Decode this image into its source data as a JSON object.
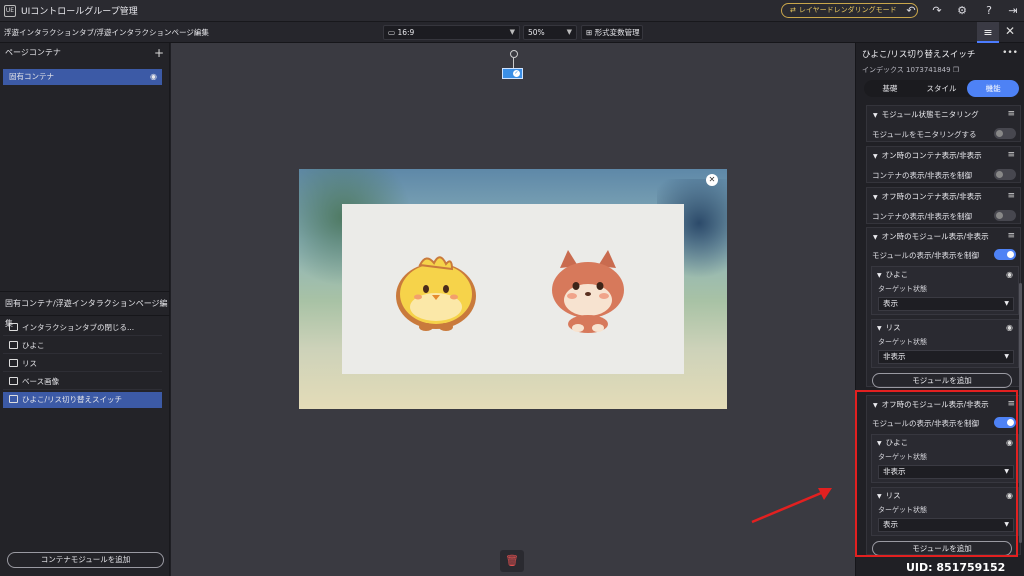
{
  "app": {
    "logo_text": "UE",
    "title": "UIコントロールグループ管理",
    "mode_button": "レイヤードレンダリングモード",
    "icons": [
      "swap-icon",
      "undo-icon",
      "redo-icon",
      "settings-icon",
      "help-icon",
      "exit-icon"
    ]
  },
  "toolbar": {
    "breadcrumb": "浮遊インタラクションタブ/浮遊インタラクションページ編集",
    "aspect": "16:9",
    "zoom": "50%",
    "format_button": "形式変数管理"
  },
  "left": {
    "page_contents_title": "ページコンテナ",
    "page_items": [
      {
        "label": "固有コンテナ"
      }
    ],
    "edit_title": "固有コンテナ/浮遊インタラクションページ編集",
    "edit_items": [
      {
        "label": "インタラクションタブの閉じる..."
      },
      {
        "label": "ひよこ"
      },
      {
        "label": "リス"
      },
      {
        "label": "ベース画像"
      },
      {
        "label": "ひよこ/リス切り替えスイッチ"
      }
    ],
    "add_container": "コンテナモジュールを追加"
  },
  "right": {
    "title": "ひよこ/リス切り替えスイッチ",
    "index": "インデックス 1073741849",
    "tabs": [
      "基礎",
      "スタイル",
      "機能"
    ],
    "active_tab": "機能",
    "groups": {
      "monitor": {
        "title": "モジュール状態モニタリング",
        "row": "モジュールをモニタリングする",
        "on": false
      },
      "on_container": {
        "title": "オン時のコンテナ表示/非表示",
        "row": "コンテナの表示/非表示を制御",
        "on": false
      },
      "off_container": {
        "title": "オフ時のコンテナ表示/非表示",
        "row": "コンテナの表示/非表示を制御",
        "on": false
      },
      "on_module": {
        "title": "オン時のモジュール表示/非表示",
        "row": "モジュールの表示/非表示を制御",
        "on": true,
        "items": [
          {
            "name": "ひよこ",
            "label": "ターゲット状態",
            "value": "表示"
          },
          {
            "name": "リス",
            "label": "ターゲット状態",
            "value": "非表示"
          }
        ],
        "add": "モジュールを追加"
      },
      "off_module": {
        "title": "オフ時のモジュール表示/非表示",
        "row": "モジュールの表示/非表示を制御",
        "on": true,
        "items": [
          {
            "name": "ひよこ",
            "label": "ターゲット状態",
            "value": "非表示"
          },
          {
            "name": "リス",
            "label": "ターゲット状態",
            "value": "表示"
          }
        ],
        "add": "モジュールを追加"
      }
    }
  },
  "uid": "UID: 851759152",
  "colors": {
    "accent": "#4e82f5",
    "highlight": "#e22020",
    "gold": "#e7c65e"
  }
}
